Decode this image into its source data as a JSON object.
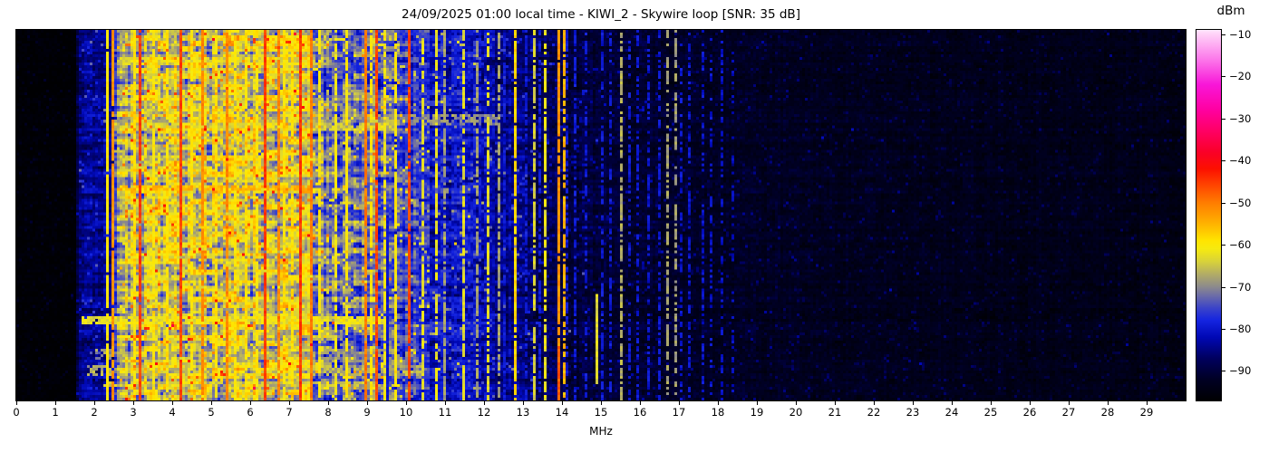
{
  "page": {
    "background": "#ffffff"
  },
  "chart_data": {
    "type": "heatmap",
    "title": "24/09/2025 01:00 local time - KIWI_2 - Skywire loop [SNR: 35 dB]",
    "xlabel": "MHz",
    "x_range": [
      0,
      30
    ],
    "x_ticks": [
      0,
      1,
      2,
      3,
      4,
      5,
      6,
      7,
      8,
      9,
      10,
      11,
      12,
      13,
      14,
      15,
      16,
      17,
      18,
      19,
      20,
      21,
      22,
      23,
      24,
      25,
      26,
      27,
      28,
      29
    ],
    "y_axis": {
      "description": "time (waterfall rows, no tick labels shown)"
    },
    "colorbar": {
      "label": "dBm",
      "ticks": [
        -10,
        -20,
        -30,
        -40,
        -50,
        -60,
        -70,
        -80,
        -90
      ],
      "vmin": -97,
      "vmax": -9,
      "stops": [
        [
          -97,
          "#000002"
        ],
        [
          -92,
          "#000024"
        ],
        [
          -87,
          "#00005e"
        ],
        [
          -82,
          "#0008b4"
        ],
        [
          -78,
          "#1424e0"
        ],
        [
          -75,
          "#3c44c8"
        ],
        [
          -72,
          "#6e6ea6"
        ],
        [
          -70,
          "#8c8a8c"
        ],
        [
          -67,
          "#b2ac66"
        ],
        [
          -64,
          "#d8d23a"
        ],
        [
          -61,
          "#f6ea10"
        ],
        [
          -59,
          "#ffe400"
        ],
        [
          -55,
          "#ffb200"
        ],
        [
          -50,
          "#ff7c00"
        ],
        [
          -46,
          "#ff4600"
        ],
        [
          -42,
          "#fc1000"
        ],
        [
          -38,
          "#fa0028"
        ],
        [
          -33,
          "#ff0064"
        ],
        [
          -28,
          "#ff00a0"
        ],
        [
          -22,
          "#f816d8"
        ],
        [
          -16,
          "#fc78ea"
        ],
        [
          -10,
          "#ffd2f8"
        ],
        [
          -9,
          "#ffe6fc"
        ]
      ]
    },
    "spectrum_profile": [
      [
        0,
        -96.5,
        1.8,
        0.5,
        0.4
      ],
      [
        1.52,
        -96.5,
        1.8,
        0.5,
        0.4
      ],
      [
        1.6,
        -85,
        4,
        2.5,
        2.2
      ],
      [
        2.5,
        -83,
        4,
        2.5,
        2.2
      ],
      [
        2.62,
        -67,
        6,
        6,
        2.5
      ],
      [
        3.4,
        -64,
        6.5,
        7,
        2.5
      ],
      [
        5.0,
        -64,
        6.5,
        7,
        2.5
      ],
      [
        7.4,
        -65,
        6.5,
        7,
        2.5
      ],
      [
        7.9,
        -73,
        6,
        6,
        2
      ],
      [
        9.0,
        -71,
        6,
        6,
        2
      ],
      [
        9.8,
        -74,
        6,
        5,
        2
      ],
      [
        10.6,
        -79,
        5,
        4,
        1.8
      ],
      [
        11.5,
        -80,
        5,
        3.5,
        1.8
      ],
      [
        12.3,
        -83,
        4.5,
        3,
        1.6
      ],
      [
        13.2,
        -86,
        4,
        2.5,
        1.6
      ],
      [
        14.2,
        -89.5,
        3.5,
        2,
        1.4
      ],
      [
        15.5,
        -91,
        3,
        1.5,
        1.2
      ],
      [
        18,
        -92,
        2.8,
        1.2,
        1
      ],
      [
        21,
        -93,
        2.5,
        1,
        0.8
      ],
      [
        26,
        -93.5,
        2.3,
        1,
        0.7
      ],
      [
        30,
        -94,
        2.2,
        1,
        0.7
      ]
    ],
    "vertical_lines": [
      {
        "f": 2.33,
        "level": -60,
        "duty": 0.9
      },
      {
        "f": 2.47,
        "level": -52,
        "duty": 0.92
      },
      {
        "f": 3.0,
        "level": -60,
        "duty": 0.9
      },
      {
        "f": 3.2,
        "level": -45.5,
        "duty": 0.97
      },
      {
        "f": 3.55,
        "level": -60,
        "duty": 0.85
      },
      {
        "f": 3.9,
        "level": -59,
        "duty": 0.9
      },
      {
        "f": 4.25,
        "level": -45.5,
        "duty": 0.97
      },
      {
        "f": 4.5,
        "level": -60,
        "duty": 0.85
      },
      {
        "f": 4.77,
        "level": -51,
        "duty": 0.9
      },
      {
        "f": 5.1,
        "level": -60,
        "duty": 0.85
      },
      {
        "f": 5.38,
        "level": -51,
        "duty": 0.9
      },
      {
        "f": 5.6,
        "level": -60,
        "duty": 0.8
      },
      {
        "f": 5.9,
        "level": -59,
        "duty": 0.85
      },
      {
        "f": 6.15,
        "level": -60,
        "duty": 0.8
      },
      {
        "f": 6.4,
        "level": -45.5,
        "duty": 0.97
      },
      {
        "f": 6.73,
        "level": -51,
        "duty": 0.9
      },
      {
        "f": 6.9,
        "level": -60,
        "duty": 0.8
      },
      {
        "f": 7.1,
        "level": -59,
        "duty": 0.85
      },
      {
        "f": 7.3,
        "level": -45,
        "duty": 1
      },
      {
        "f": 7.58,
        "level": -50,
        "duty": 0.95
      },
      {
        "f": 7.75,
        "level": -60,
        "duty": 0.85
      },
      {
        "f": 8.2,
        "level": -61,
        "duty": 0.8
      },
      {
        "f": 8.5,
        "level": -60,
        "duty": 0.85
      },
      {
        "f": 8.95,
        "level": -50,
        "duty": 0.95
      },
      {
        "f": 9.1,
        "level": -60,
        "duty": 0.8
      },
      {
        "f": 9.25,
        "level": -46,
        "duty": 0.97
      },
      {
        "f": 9.45,
        "level": -61,
        "duty": 0.8
      },
      {
        "f": 9.55,
        "level": -79.5,
        "y0": 0.5,
        "mode": "set"
      },
      {
        "f": 9.75,
        "level": -60,
        "duty": 0.8
      },
      {
        "f": 10.1,
        "level": -46,
        "duty": 0.97
      },
      {
        "f": 10.3,
        "level": -79.5,
        "duty": 0.65
      },
      {
        "f": 10.45,
        "level": -63,
        "duty": 0.8
      },
      {
        "f": 10.75,
        "level": -62,
        "duty": 0.8
      },
      {
        "f": 10.9,
        "level": -79.5,
        "duty": 0.65
      },
      {
        "f": 11.0,
        "level": -68,
        "duty": 0.75
      },
      {
        "f": 11.3,
        "level": -79.5,
        "duty": 0.65
      },
      {
        "f": 11.5,
        "level": -63,
        "duty": 0.8
      },
      {
        "f": 11.8,
        "level": -68,
        "duty": 0.75
      },
      {
        "f": 11.9,
        "level": -79.5,
        "duty": 0.6
      },
      {
        "f": 12.1,
        "level": -63,
        "duty": 0.75
      },
      {
        "f": 12.4,
        "level": -68,
        "duty": 0.7
      },
      {
        "f": 12.55,
        "level": -79.5,
        "duty": 0.6
      },
      {
        "f": 12.8,
        "level": -58,
        "duty": 0.92
      },
      {
        "f": 13.1,
        "level": -79.5,
        "duty": 0.6
      },
      {
        "f": 13.3,
        "level": -64,
        "duty": 0.75
      },
      {
        "f": 13.45,
        "level": -79.5,
        "duty": 0.6
      },
      {
        "f": 13.6,
        "level": -62,
        "duty": 0.8
      },
      {
        "f": 13.9,
        "level": -52,
        "duty": 0.92
      },
      {
        "f": 13.9,
        "level": -47,
        "y0": 0.86
      },
      {
        "f": 14.05,
        "level": -55,
        "duty": 0.7
      },
      {
        "f": 14.1,
        "level": -79.5,
        "duty": 0.6
      },
      {
        "f": 14.35,
        "level": -79.5,
        "duty": 0.55
      },
      {
        "f": 14.6,
        "level": -79.5,
        "duty": 0.55
      },
      {
        "f": 14.87,
        "level": -63.5,
        "y0": 0.715,
        "y1": 0.955
      },
      {
        "f": 15.05,
        "level": -79.5,
        "duty": 0.55
      },
      {
        "f": 15.25,
        "level": -79.5,
        "duty": 0.5
      },
      {
        "f": 15.5,
        "level": -67,
        "duty": 0.7
      },
      {
        "f": 15.7,
        "level": -79.5,
        "duty": 0.5
      },
      {
        "f": 15.95,
        "level": -80,
        "duty": 0.5
      },
      {
        "f": 16.2,
        "level": -80,
        "duty": 0.5
      },
      {
        "f": 16.5,
        "level": -80,
        "duty": 0.5
      },
      {
        "f": 16.7,
        "level": -68,
        "duty": 0.65
      },
      {
        "f": 16.95,
        "level": -68.5,
        "duty": 0.6
      },
      {
        "f": 17.05,
        "level": -80,
        "duty": 0.5
      },
      {
        "f": 17.3,
        "level": -80,
        "duty": 0.5
      },
      {
        "f": 17.6,
        "level": -80,
        "duty": 0.45
      },
      {
        "f": 17.85,
        "level": -80.5,
        "duty": 0.45
      },
      {
        "f": 18.1,
        "level": -81,
        "duty": 0.4
      },
      {
        "f": 18.4,
        "level": -81.5,
        "duty": 0.35
      }
    ],
    "horizontal_events": [
      {
        "y0": 0.075,
        "y1": 0.09,
        "f0": 2.6,
        "f1": 7.6,
        "level": -64,
        "duty": 0.8
      },
      {
        "y0": 0.228,
        "y1": 0.252,
        "f0": 2.5,
        "f1": 12.3,
        "level": -70,
        "duty": 0.7
      },
      {
        "y0": 0.252,
        "y1": 0.268,
        "f0": 2.5,
        "f1": 9.7,
        "level": -65,
        "duty": 0.85
      },
      {
        "y0": 0.42,
        "y1": 0.433,
        "f0": 2.6,
        "f1": 7.5,
        "level": -56,
        "duty": 0.85
      },
      {
        "y0": 0.773,
        "y1": 0.787,
        "f0": 1.7,
        "f1": 9.4,
        "level": -62.5,
        "duty": 0.9
      },
      {
        "y0": 0.862,
        "y1": 0.885,
        "f0": 2.0,
        "f1": 10.2,
        "level": -69,
        "duty": 0.6
      },
      {
        "y0": 0.908,
        "y1": 0.932,
        "f0": 1.8,
        "f1": 10.3,
        "level": -67.5,
        "duty": 0.65
      },
      {
        "y0": 0.953,
        "y1": 0.962,
        "f0": 2.2,
        "f1": 9.0,
        "level": -66,
        "duty": 0.7
      }
    ],
    "render": {
      "cols": 430,
      "rows": 136,
      "seed": 11
    }
  }
}
